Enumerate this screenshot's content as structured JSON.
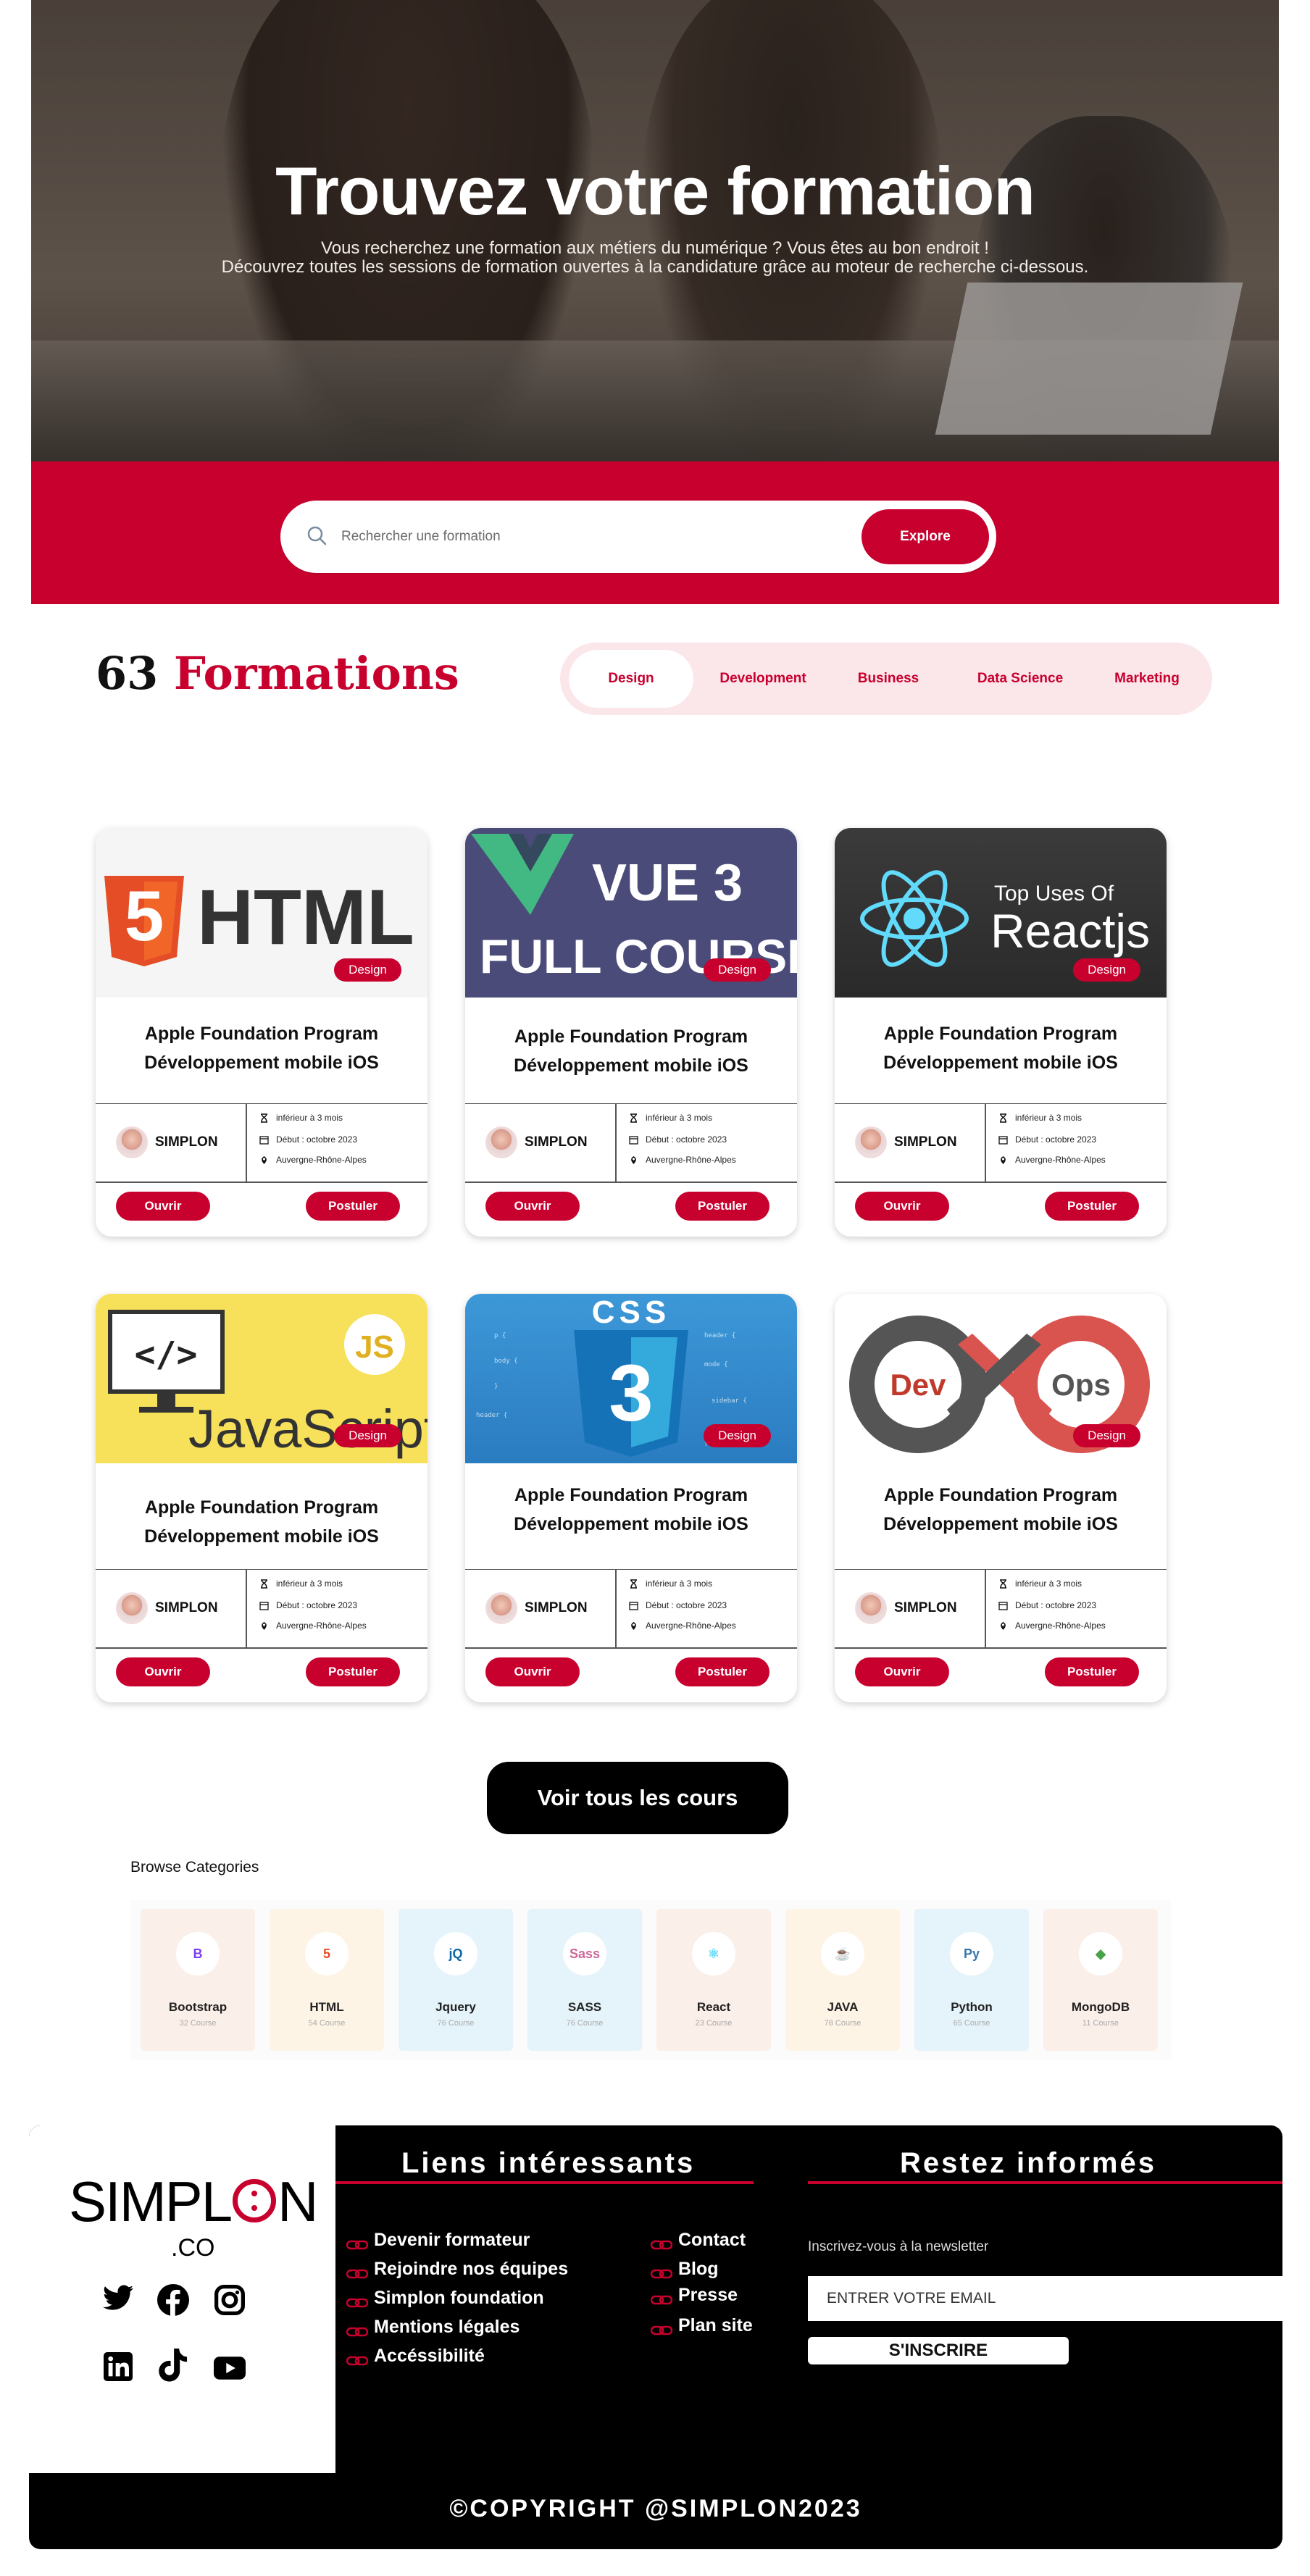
{
  "hero": {
    "title": "Trouvez votre formation",
    "line1": "Vous recherchez une formation aux métiers du numérique ? Vous êtes au bon endroit !",
    "line2": "Découvrez toutes les sessions de formation ouvertes à la candidature grâce au moteur de recherche ci-dessous."
  },
  "search": {
    "placeholder": "Rechercher une formation",
    "button": "Explore"
  },
  "formations": {
    "count": "63",
    "word": "Formations"
  },
  "tabs": [
    "Design",
    "Development",
    "Business",
    "Data Science",
    "Marketing"
  ],
  "colors": {
    "accent": "#c8002e",
    "tab_bg": "#fbe6ea"
  },
  "cards": [
    {
      "image": "html-logo",
      "tag": "Design",
      "title1": "Apple Foundation Program",
      "title2": "Développement mobile iOS",
      "org": "SIMPLON",
      "duration": "inférieur à 3 mois",
      "start": "Début : octobre 2023",
      "location": "Auvergne-Rhône-Alpes",
      "btn_open": "Ouvrir",
      "btn_apply": "Postuler"
    },
    {
      "image": "vue3-banner",
      "img_text1": "VUE 3",
      "img_text2": "FULL COURSE",
      "tag": "Design",
      "title1": "Apple Foundation Program",
      "title2": "Développement mobile iOS",
      "org": "SIMPLON",
      "duration": "inférieur à 3 mois",
      "start": "Début : octobre 2023",
      "location": "Auvergne-Rhône-Alpes",
      "btn_open": "Ouvrir",
      "btn_apply": "Postuler"
    },
    {
      "image": "react-banner",
      "img_text1": "Top Uses Of",
      "img_text2": "Reactjs",
      "tag": "Design",
      "title1": "Apple Foundation Program",
      "title2": "Développement mobile iOS",
      "org": "SIMPLON",
      "duration": "inférieur à 3 mois",
      "start": "Début : octobre 2023",
      "location": "Auvergne-Rhône-Alpes",
      "btn_open": "Ouvrir",
      "btn_apply": "Postuler"
    },
    {
      "image": "javascript-banner",
      "img_text1": "JavaScript",
      "tag": "Design",
      "title1": "Apple Foundation Program",
      "title2": "Développement mobile iOS",
      "org": "SIMPLON",
      "duration": "inférieur à 3 mois",
      "start": "Début : octobre 2023",
      "location": "Auvergne-Rhône-Alpes",
      "btn_open": "Ouvrir",
      "btn_apply": "Postuler"
    },
    {
      "image": "css3-banner",
      "img_text1": "CSS",
      "tag": "Design",
      "title1": "Apple Foundation Program",
      "title2": "Développement mobile iOS",
      "org": "SIMPLON",
      "duration": "inférieur à 3 mois",
      "start": "Début : octobre 2023",
      "location": "Auvergne-Rhône-Alpes",
      "btn_open": "Ouvrir",
      "btn_apply": "Postuler"
    },
    {
      "image": "devops-banner",
      "img_text1": "Dev",
      "img_text2": "Ops",
      "tag": "Design",
      "title1": "Apple Foundation Program",
      "title2": "Développement mobile iOS",
      "org": "SIMPLON",
      "duration": "inférieur à 3 mois",
      "start": "Début : octobre 2023",
      "location": "Auvergne-Rhône-Alpes",
      "btn_open": "Ouvrir",
      "btn_apply": "Postuler"
    }
  ],
  "voir_tous": "Voir tous les cours",
  "browse": {
    "title": "Browse Categories",
    "items": [
      {
        "name": "Bootstrap",
        "count": "32 Course",
        "icon": "bootstrap-icon",
        "glyph": "B",
        "bg": "#fbefe9"
      },
      {
        "name": "HTML",
        "count": "54 Course",
        "icon": "html5-icon",
        "glyph": "5",
        "bg": "#fdf4e6"
      },
      {
        "name": "Jquery",
        "count": "76 Course",
        "icon": "jquery-icon",
        "glyph": "jQ",
        "bg": "#e5f4fa"
      },
      {
        "name": "SASS",
        "count": "76 Course",
        "icon": "sass-icon",
        "glyph": "Sass",
        "bg": "#e5f4fa"
      },
      {
        "name": "React",
        "count": "23 Course",
        "icon": "react-icon",
        "glyph": "⚛",
        "bg": "#fbefe9"
      },
      {
        "name": "JAVA",
        "count": "78 Course",
        "icon": "java-icon",
        "glyph": "☕",
        "bg": "#fdf4e6"
      },
      {
        "name": "Python",
        "count": "65 Course",
        "icon": "python-icon",
        "glyph": "Py",
        "bg": "#e5f4fa"
      },
      {
        "name": "MongoDB",
        "count": "11 Course",
        "icon": "mongodb-icon",
        "glyph": "◆",
        "bg": "#fbefe9"
      }
    ]
  },
  "footer": {
    "logo": "SIMPL N",
    "logo_sub": ".CO",
    "social": [
      "twitter-icon",
      "facebook-icon",
      "instagram-icon",
      "linkedin-icon",
      "tiktok-icon",
      "youtube-icon"
    ],
    "links_title": "Liens intéressants",
    "links_col1": [
      "Devenir formateur",
      "Rejoindre nos équipes",
      "Simplon foundation",
      "Mentions légales",
      "Accéssibilité"
    ],
    "links_col2": [
      "Contact",
      "Blog",
      "Presse",
      "Plan site"
    ],
    "news_title": "Restez informés",
    "news_text": "Inscrivez-vous à la newsletter",
    "email_placeholder": "ENTRER VOTRE EMAIL",
    "subscribe": "S'INSCRIRE",
    "copyright": "©COPYRIGHT @SIMPLON2023"
  }
}
